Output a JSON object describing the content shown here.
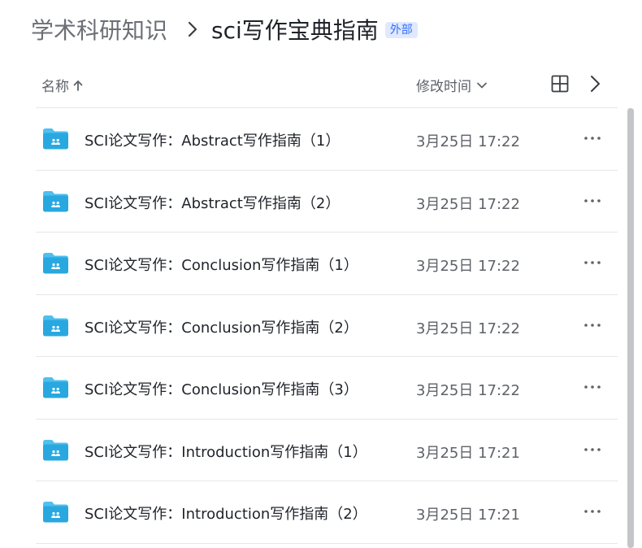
{
  "breadcrumb": {
    "parent": "学术科研知识",
    "current": "sci写作宝典指南",
    "badge": "外部"
  },
  "header": {
    "name_label": "名称",
    "time_label": "修改时间"
  },
  "icons": {
    "folder": "shared-folder-icon",
    "sort": "arrow-up-icon",
    "dropdown": "chevron-down-icon",
    "grid": "grid-view-icon",
    "next": "chevron-right-icon",
    "more": "more-horizontal-icon"
  },
  "colors": {
    "folder": "#29a8e0",
    "folder_tab": "#4fc0ee",
    "badge_bg": "#e1e9ff",
    "badge_text": "#3370ff"
  },
  "files": [
    {
      "name": "SCI论文写作：Abstract写作指南（1）",
      "time": "3月25日 17:22"
    },
    {
      "name": "SCI论文写作：Abstract写作指南（2）",
      "time": "3月25日 17:22"
    },
    {
      "name": "SCI论文写作：Conclusion写作指南（1）",
      "time": "3月25日 17:22"
    },
    {
      "name": "SCI论文写作：Conclusion写作指南（2）",
      "time": "3月25日 17:22"
    },
    {
      "name": "SCI论文写作：Conclusion写作指南（3）",
      "time": "3月25日 17:22"
    },
    {
      "name": "SCI论文写作：Introduction写作指南（1）",
      "time": "3月25日 17:21"
    },
    {
      "name": "SCI论文写作：Introduction写作指南（2）",
      "time": "3月25日 17:21"
    }
  ]
}
